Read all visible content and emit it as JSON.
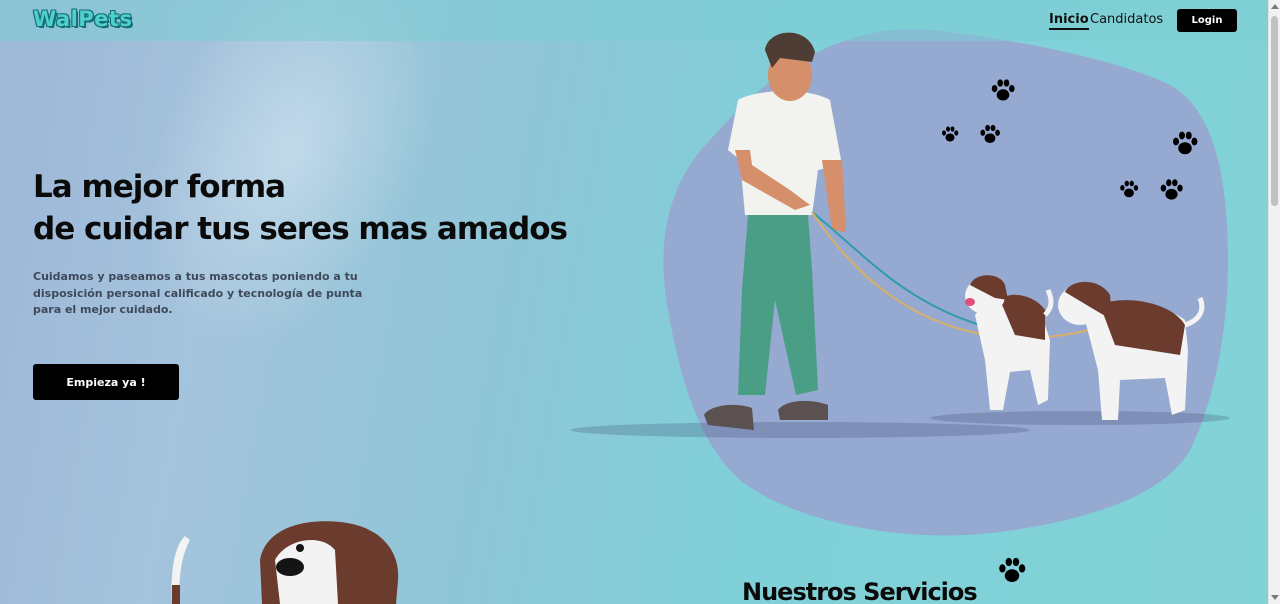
{
  "brand": {
    "name": "WalPets"
  },
  "nav": {
    "items": [
      {
        "label": "Inicio",
        "active": true
      },
      {
        "label": "Candidatos",
        "active": false
      }
    ],
    "login_label": "Login"
  },
  "hero": {
    "title_line1": "La mejor forma",
    "title_line2": "de cuidar tus seres mas amados",
    "description": "Cuidamos y paseamos a tus mascotas poniendo a tu disposición personal calificado y tecnología de punta para el mejor cuidado.",
    "cta_label": "Empieza ya !"
  },
  "services": {
    "title": "Nuestros Servicios"
  },
  "icons": [
    "paw-icon",
    "chevron-up-icon",
    "chevron-down-icon"
  ],
  "colors": {
    "accent": "#4fd0cc",
    "blob": "#95a9d1",
    "button": "#000000",
    "text": "#0a0a0a"
  }
}
